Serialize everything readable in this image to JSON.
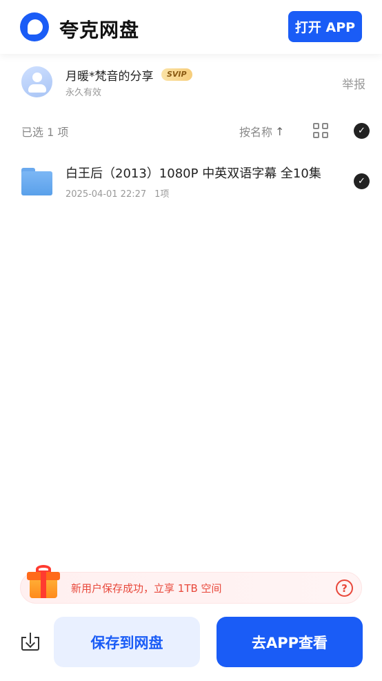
{
  "header": {
    "app_name": "夸克网盘",
    "open_app_label": "打开 APP"
  },
  "share": {
    "sharer_name": "月暖*梵音的分享",
    "badge": "SVIP",
    "validity": "永久有效",
    "report_label": "举报"
  },
  "toolbar": {
    "selected_count": "已选 1 项",
    "sort_label": "按名称",
    "sort_arrow": "↑",
    "check_mark": "✓"
  },
  "files": [
    {
      "name": "白王后（2013）1080P 中英双语字幕 全10集",
      "date": "2025-04-01 22:27",
      "items": "1项",
      "check_mark": "✓",
      "selected": true
    }
  ],
  "promo": {
    "text": "新用户保存成功，立享 1TB 空间",
    "help": "?"
  },
  "actions": {
    "save_label": "保存到网盘",
    "view_label": "去APP查看"
  },
  "colors": {
    "brand_blue": "#1a5cf6",
    "promo_red": "#e8483b"
  }
}
